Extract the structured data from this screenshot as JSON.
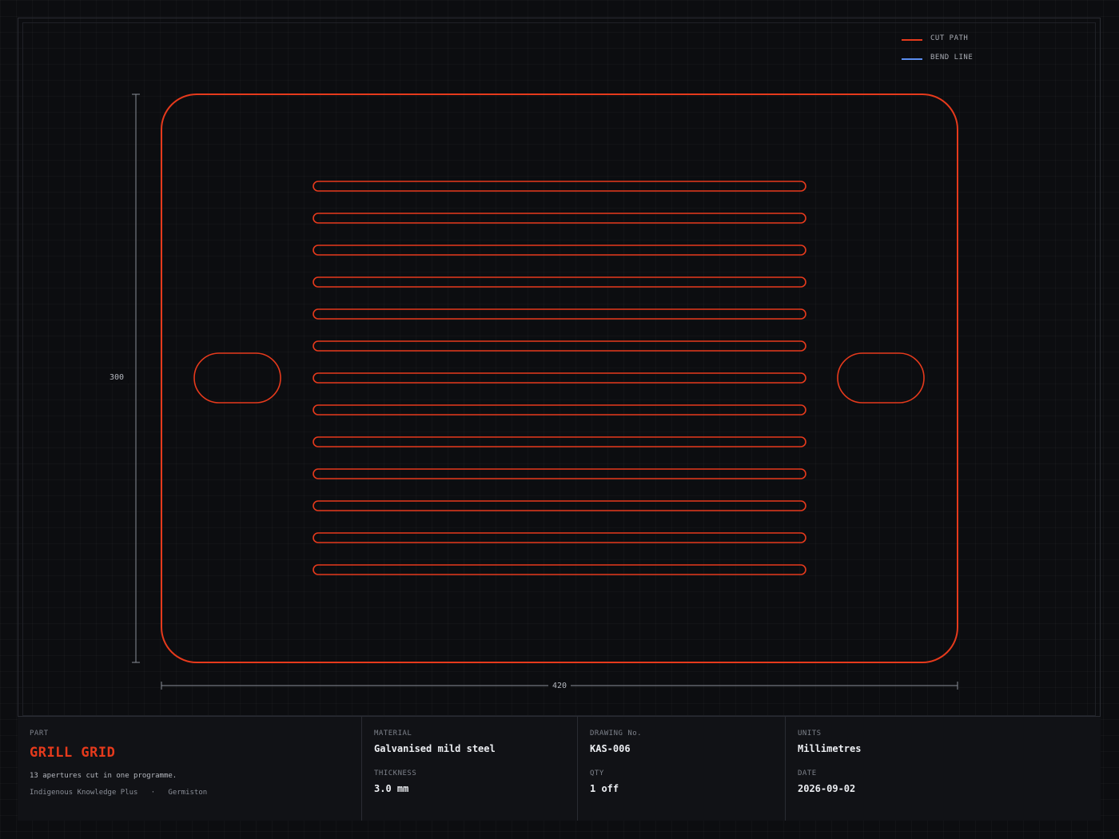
{
  "colors": {
    "cut": "#e63a1c",
    "bend": "#5b8def",
    "dimension": "#8a8e97"
  },
  "legend": [
    {
      "label": "CUT PATH",
      "color": "#e63a1c"
    },
    {
      "label": "BEND LINE",
      "color": "#5b8def"
    }
  ],
  "dimensions": {
    "width": "420",
    "height": "300"
  },
  "part": {
    "label": "PART",
    "name": "GRILL GRID",
    "description": "13 apertures cut in one programme.",
    "organisation": "Indigenous Knowledge Plus",
    "separator": "·",
    "location": "Germiston"
  },
  "material": {
    "label": "MATERIAL",
    "value": "Galvanised mild steel"
  },
  "thickness": {
    "label": "THICKNESS",
    "value": "3.0 mm"
  },
  "drawing_no": {
    "label": "DRAWING No.",
    "value": "KAS-006"
  },
  "qty": {
    "label": "QTY",
    "value": "1 off"
  },
  "units": {
    "label": "UNITS",
    "value": "Millimetres"
  },
  "date": {
    "label": "DATE",
    "value": "2026-09-02"
  }
}
